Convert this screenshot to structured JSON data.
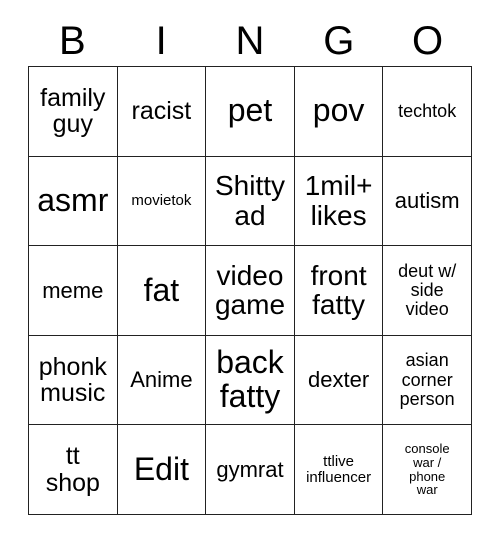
{
  "card": {
    "title": "BINGO",
    "header_letters": [
      "B",
      "I",
      "N",
      "G",
      "O"
    ],
    "grid": {
      "rows": 5,
      "columns": 5,
      "border_color": "#222222",
      "background_color": "#ffffff",
      "text_color": "#000000"
    },
    "cells": [
      {
        "text": "family\nguy",
        "size": "lg"
      },
      {
        "text": "racist",
        "size": "lg"
      },
      {
        "text": "pet",
        "size": "xxl"
      },
      {
        "text": "pov",
        "size": "xxl"
      },
      {
        "text": "techtok",
        "size": "sm"
      },
      {
        "text": "asmr",
        "size": "xxl"
      },
      {
        "text": "movietok",
        "size": "xs"
      },
      {
        "text": "Shitty\nad",
        "size": "xl"
      },
      {
        "text": "1mil+\nlikes",
        "size": "xl"
      },
      {
        "text": "autism",
        "size": "md"
      },
      {
        "text": "meme",
        "size": "md"
      },
      {
        "text": "fat",
        "size": "xxl"
      },
      {
        "text": "video\ngame",
        "size": "xl"
      },
      {
        "text": "front\nfatty",
        "size": "xl"
      },
      {
        "text": "deut w/\nside\nvideo",
        "size": "sm"
      },
      {
        "text": "phonk\nmusic",
        "size": "lg"
      },
      {
        "text": "Anime",
        "size": "md"
      },
      {
        "text": "back\nfatty",
        "size": "xxl"
      },
      {
        "text": "dexter",
        "size": "md"
      },
      {
        "text": "asian\ncorner\nperson",
        "size": "sm"
      },
      {
        "text": "tt\nshop",
        "size": "lg"
      },
      {
        "text": "Edit",
        "size": "xxl"
      },
      {
        "text": "gymrat",
        "size": "md"
      },
      {
        "text": "ttlive\ninfluencer",
        "size": "xs"
      },
      {
        "text": "console\nwar /\nphone\nwar",
        "size": "xxs"
      }
    ]
  }
}
